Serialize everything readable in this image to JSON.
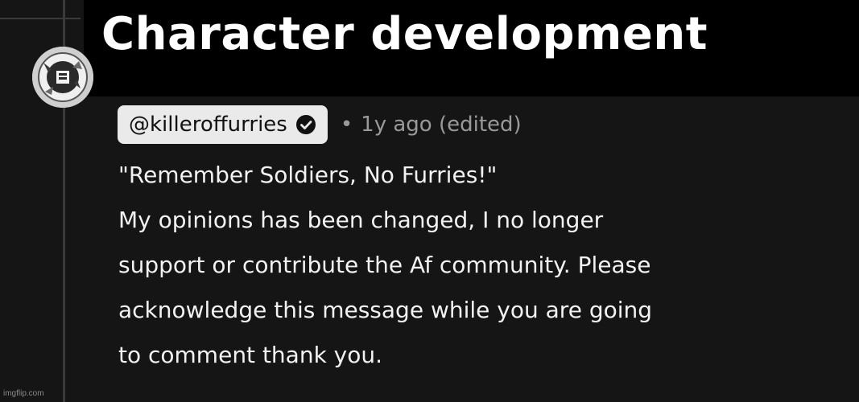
{
  "caption": {
    "text": "Character development"
  },
  "comment": {
    "author_handle": "@killeroffurries",
    "verified": true,
    "separator": "•",
    "timestamp": "1y ago (edited)",
    "lines": [
      "\"Remember Soldiers, No Furries!\"",
      "My opinions has been changed, I no longer",
      "support or contribute the Af community. Please",
      "acknowledge this message while you are going",
      "to comment thank you."
    ]
  },
  "watermark": {
    "text": "imgflip.com"
  },
  "colors": {
    "background": "#151515",
    "caption_background": "#000000",
    "chip_background": "#eaeaea",
    "body_text": "#f2f2f2",
    "meta_text": "#9a9a9a"
  },
  "icons": {
    "verified": "verified-check-icon",
    "avatar": "user-avatar"
  }
}
